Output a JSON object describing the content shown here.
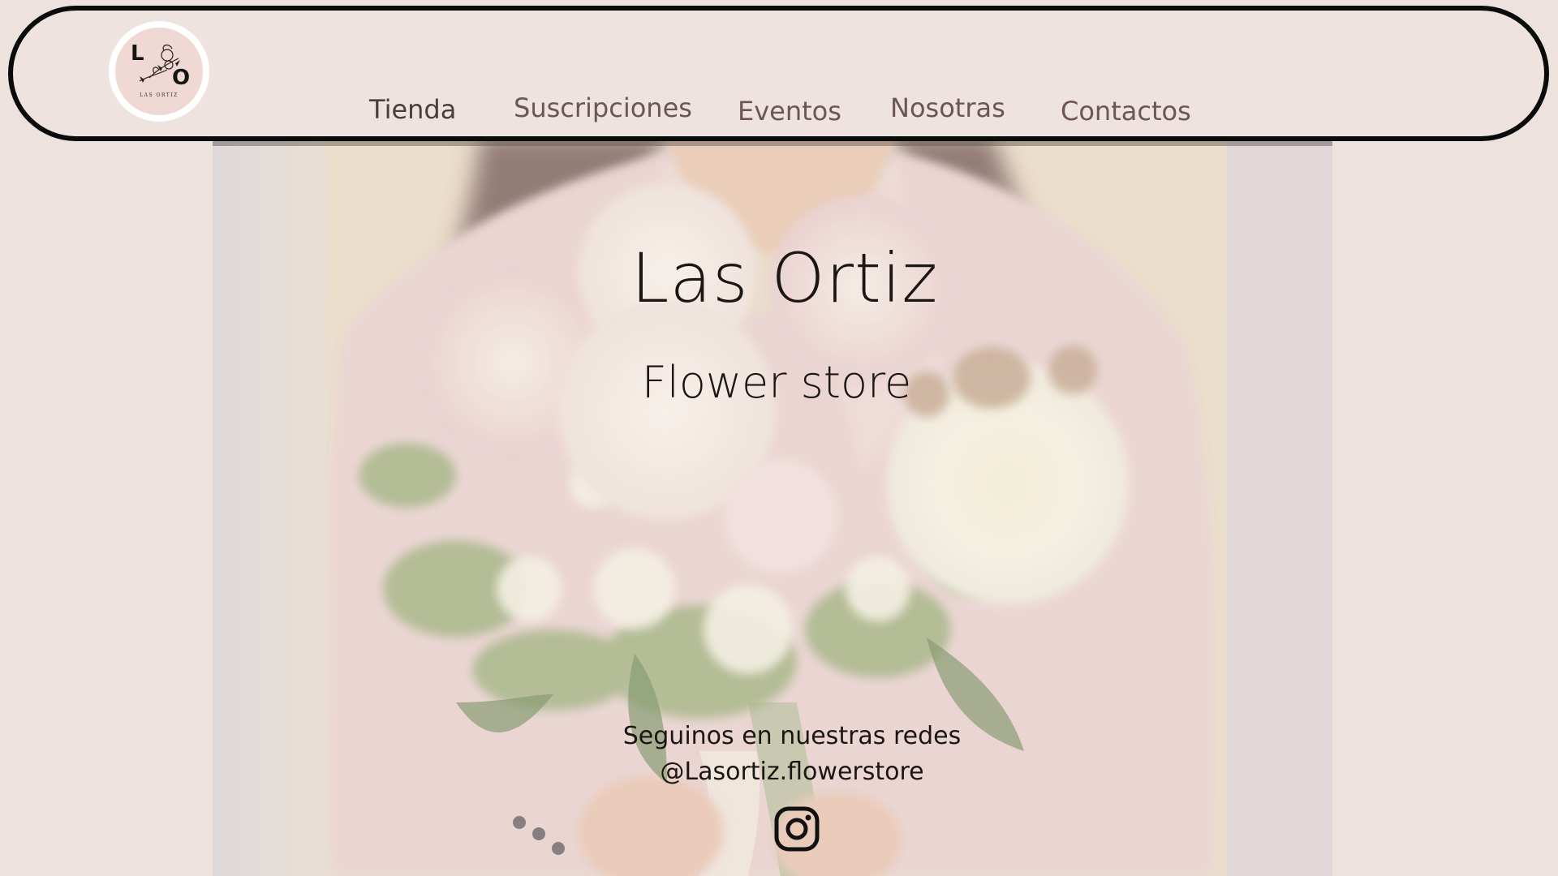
{
  "header": {
    "logo": {
      "letters": [
        "L",
        "O"
      ],
      "caption": "LAS ORTIZ"
    },
    "nav": [
      {
        "label": "Tienda",
        "active": true
      },
      {
        "label": "Suscripciones",
        "active": false
      },
      {
        "label": "Eventos",
        "active": false
      },
      {
        "label": "Nosotras",
        "active": false
      },
      {
        "label": "Contactos",
        "active": false
      }
    ]
  },
  "hero": {
    "title": "Las Ortiz",
    "subtitle": "Flower store",
    "social_line": "Seguinos en nuestras redes",
    "social_handle": "@Lasortiz.flowerstore",
    "social_icon": "instagram-icon"
  },
  "colors": {
    "background": "#ede2de",
    "header_border": "#0b0b0b",
    "nav_text": "#6b5556",
    "hero_text": "#1b1513"
  }
}
